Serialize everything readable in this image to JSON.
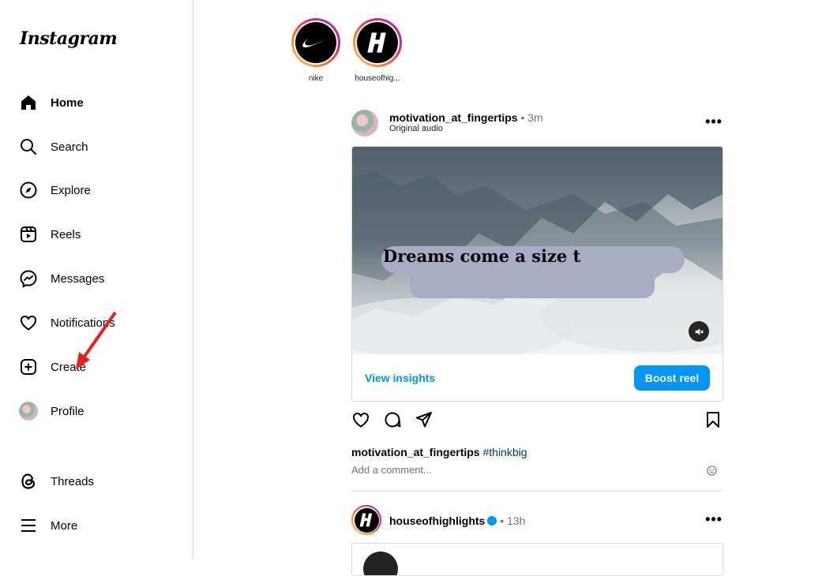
{
  "app": {
    "logo_text": "Instagram"
  },
  "sidebar": {
    "items": [
      {
        "label": "Home",
        "icon": "home-icon",
        "active": true
      },
      {
        "label": "Search",
        "icon": "search-icon"
      },
      {
        "label": "Explore",
        "icon": "compass-icon"
      },
      {
        "label": "Reels",
        "icon": "reels-icon"
      },
      {
        "label": "Messages",
        "icon": "messenger-icon"
      },
      {
        "label": "Notifications",
        "icon": "heart-icon"
      },
      {
        "label": "Create",
        "icon": "plus-square-icon"
      },
      {
        "label": "Profile",
        "icon": "profile-avatar"
      },
      {
        "label": "Threads",
        "icon": "threads-icon"
      },
      {
        "label": "More",
        "icon": "menu-icon"
      }
    ]
  },
  "stories": [
    {
      "username": "nike",
      "avatar_icon": "nike-swoosh-icon"
    },
    {
      "username": "houseofhig...",
      "avatar_icon": "house-of-highlights-logo-icon"
    }
  ],
  "post1": {
    "username": "motivation_at_fingertips",
    "time": "• 3m",
    "subtitle": "Original audio",
    "overlay_text": "Dreams come a size t",
    "view_insights_label": "View insights",
    "boost_label": "Boost reel",
    "caption_user": "motivation_at_fingertips",
    "caption_tag": "#thinkbig",
    "comment_placeholder": "Add a comment..."
  },
  "post2": {
    "username": "houseofhighlights",
    "time": "• 13h"
  },
  "colors": {
    "accent": "#0095f6",
    "annotation_arrow": "#e8201a"
  }
}
